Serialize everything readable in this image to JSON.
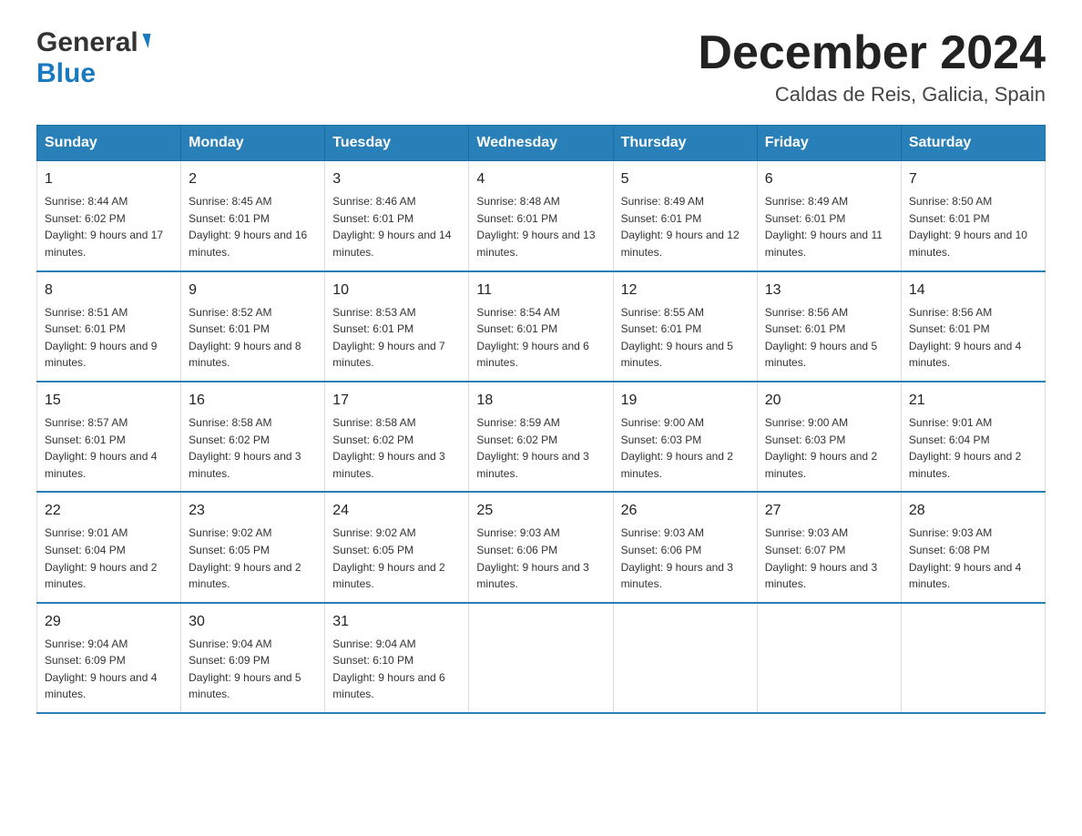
{
  "header": {
    "logo_general": "General",
    "logo_blue": "Blue",
    "month_title": "December 2024",
    "location": "Caldas de Reis, Galicia, Spain"
  },
  "columns": [
    "Sunday",
    "Monday",
    "Tuesday",
    "Wednesday",
    "Thursday",
    "Friday",
    "Saturday"
  ],
  "weeks": [
    [
      {
        "day": "1",
        "sunrise": "8:44 AM",
        "sunset": "6:02 PM",
        "daylight": "9 hours and 17 minutes."
      },
      {
        "day": "2",
        "sunrise": "8:45 AM",
        "sunset": "6:01 PM",
        "daylight": "9 hours and 16 minutes."
      },
      {
        "day": "3",
        "sunrise": "8:46 AM",
        "sunset": "6:01 PM",
        "daylight": "9 hours and 14 minutes."
      },
      {
        "day": "4",
        "sunrise": "8:48 AM",
        "sunset": "6:01 PM",
        "daylight": "9 hours and 13 minutes."
      },
      {
        "day": "5",
        "sunrise": "8:49 AM",
        "sunset": "6:01 PM",
        "daylight": "9 hours and 12 minutes."
      },
      {
        "day": "6",
        "sunrise": "8:49 AM",
        "sunset": "6:01 PM",
        "daylight": "9 hours and 11 minutes."
      },
      {
        "day": "7",
        "sunrise": "8:50 AM",
        "sunset": "6:01 PM",
        "daylight": "9 hours and 10 minutes."
      }
    ],
    [
      {
        "day": "8",
        "sunrise": "8:51 AM",
        "sunset": "6:01 PM",
        "daylight": "9 hours and 9 minutes."
      },
      {
        "day": "9",
        "sunrise": "8:52 AM",
        "sunset": "6:01 PM",
        "daylight": "9 hours and 8 minutes."
      },
      {
        "day": "10",
        "sunrise": "8:53 AM",
        "sunset": "6:01 PM",
        "daylight": "9 hours and 7 minutes."
      },
      {
        "day": "11",
        "sunrise": "8:54 AM",
        "sunset": "6:01 PM",
        "daylight": "9 hours and 6 minutes."
      },
      {
        "day": "12",
        "sunrise": "8:55 AM",
        "sunset": "6:01 PM",
        "daylight": "9 hours and 5 minutes."
      },
      {
        "day": "13",
        "sunrise": "8:56 AM",
        "sunset": "6:01 PM",
        "daylight": "9 hours and 5 minutes."
      },
      {
        "day": "14",
        "sunrise": "8:56 AM",
        "sunset": "6:01 PM",
        "daylight": "9 hours and 4 minutes."
      }
    ],
    [
      {
        "day": "15",
        "sunrise": "8:57 AM",
        "sunset": "6:01 PM",
        "daylight": "9 hours and 4 minutes."
      },
      {
        "day": "16",
        "sunrise": "8:58 AM",
        "sunset": "6:02 PM",
        "daylight": "9 hours and 3 minutes."
      },
      {
        "day": "17",
        "sunrise": "8:58 AM",
        "sunset": "6:02 PM",
        "daylight": "9 hours and 3 minutes."
      },
      {
        "day": "18",
        "sunrise": "8:59 AM",
        "sunset": "6:02 PM",
        "daylight": "9 hours and 3 minutes."
      },
      {
        "day": "19",
        "sunrise": "9:00 AM",
        "sunset": "6:03 PM",
        "daylight": "9 hours and 2 minutes."
      },
      {
        "day": "20",
        "sunrise": "9:00 AM",
        "sunset": "6:03 PM",
        "daylight": "9 hours and 2 minutes."
      },
      {
        "day": "21",
        "sunrise": "9:01 AM",
        "sunset": "6:04 PM",
        "daylight": "9 hours and 2 minutes."
      }
    ],
    [
      {
        "day": "22",
        "sunrise": "9:01 AM",
        "sunset": "6:04 PM",
        "daylight": "9 hours and 2 minutes."
      },
      {
        "day": "23",
        "sunrise": "9:02 AM",
        "sunset": "6:05 PM",
        "daylight": "9 hours and 2 minutes."
      },
      {
        "day": "24",
        "sunrise": "9:02 AM",
        "sunset": "6:05 PM",
        "daylight": "9 hours and 2 minutes."
      },
      {
        "day": "25",
        "sunrise": "9:03 AM",
        "sunset": "6:06 PM",
        "daylight": "9 hours and 3 minutes."
      },
      {
        "day": "26",
        "sunrise": "9:03 AM",
        "sunset": "6:06 PM",
        "daylight": "9 hours and 3 minutes."
      },
      {
        "day": "27",
        "sunrise": "9:03 AM",
        "sunset": "6:07 PM",
        "daylight": "9 hours and 3 minutes."
      },
      {
        "day": "28",
        "sunrise": "9:03 AM",
        "sunset": "6:08 PM",
        "daylight": "9 hours and 4 minutes."
      }
    ],
    [
      {
        "day": "29",
        "sunrise": "9:04 AM",
        "sunset": "6:09 PM",
        "daylight": "9 hours and 4 minutes."
      },
      {
        "day": "30",
        "sunrise": "9:04 AM",
        "sunset": "6:09 PM",
        "daylight": "9 hours and 5 minutes."
      },
      {
        "day": "31",
        "sunrise": "9:04 AM",
        "sunset": "6:10 PM",
        "daylight": "9 hours and 6 minutes."
      },
      null,
      null,
      null,
      null
    ]
  ],
  "labels": {
    "sunrise": "Sunrise:",
    "sunset": "Sunset:",
    "daylight": "Daylight:"
  }
}
